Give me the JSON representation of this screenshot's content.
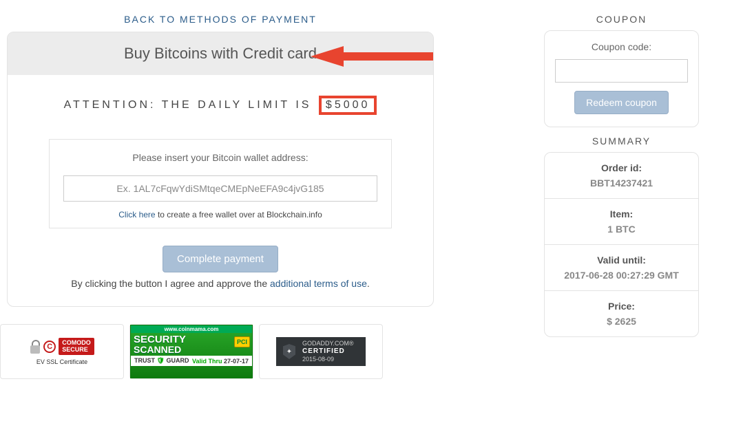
{
  "back_link": "BACK TO METHODS OF PAYMENT",
  "card": {
    "title": "Buy Bitcoins with Credit card",
    "attention_prefix": "ATTENTION: THE DAILY LIMIT IS",
    "attention_amount": "$5000",
    "wallet_label": "Please insert your Bitcoin wallet address:",
    "wallet_placeholder": "Ex. 1AL7cFqwYdiSMtqeCMEpNeEFA9c4jvG185",
    "wallet_hint_link": "Click here",
    "wallet_hint_rest": " to create a free wallet over at Blockchain.info",
    "complete_button": "Complete payment",
    "agree_prefix": "By clicking the button I agree and approve the ",
    "agree_link": "additional terms of use",
    "agree_suffix": "."
  },
  "coupon": {
    "section_title": "COUPON",
    "label": "Coupon code:",
    "button": "Redeem coupon"
  },
  "summary": {
    "section_title": "SUMMARY",
    "rows": [
      {
        "key": "Order id:",
        "val": "BBT14237421"
      },
      {
        "key": "Item:",
        "val": "1 BTC"
      },
      {
        "key": "Valid until:",
        "val": "2017-06-28 00:27:29 GMT"
      },
      {
        "key": "Price:",
        "val": "$ 2625"
      }
    ]
  },
  "badges": {
    "comodo_brand": "COMODO",
    "comodo_secure": "SECURE",
    "comodo_sub": "EV SSL Certificate",
    "sec_url": "www.coinmama.com",
    "sec_line1": "SECURITY",
    "sec_line2": "SCANNED",
    "sec_pci": "PCI",
    "sec_trust": "TRUST",
    "sec_guard": "GUARD",
    "sec_valid": "Valid Thru",
    "sec_date": "27-07-17",
    "gd_top": "GODADDY.COM®",
    "gd_mid": "CERTIFIED",
    "gd_date": "2015-08-09"
  }
}
